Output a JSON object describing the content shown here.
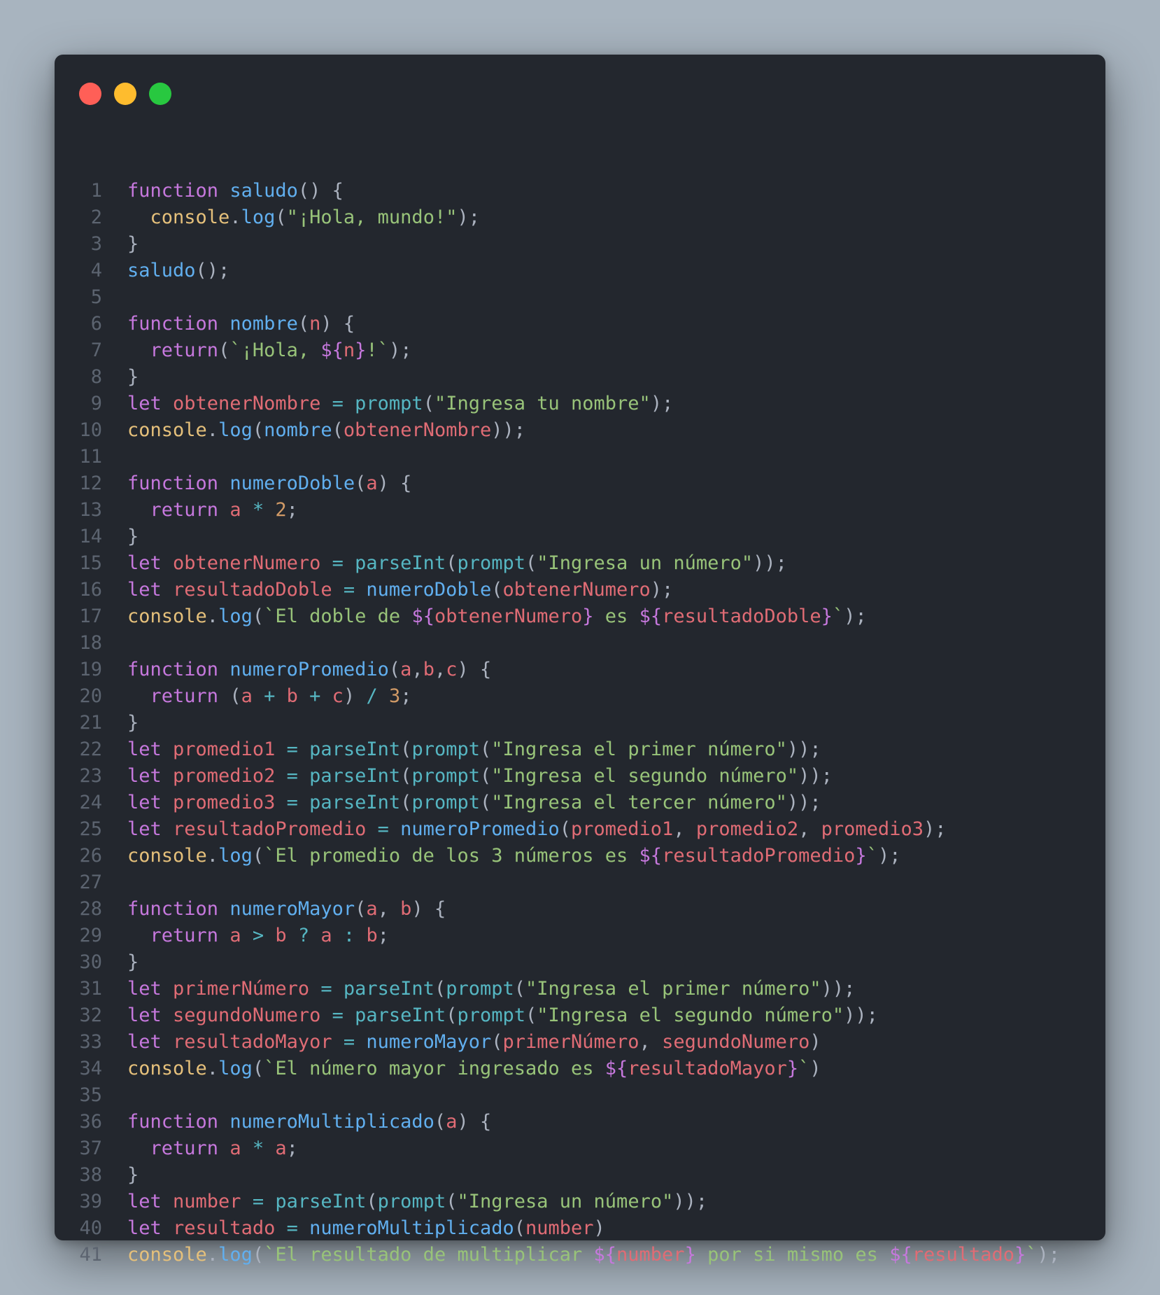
{
  "window": {
    "buttons": [
      "close",
      "minimize",
      "maximize"
    ],
    "colors": {
      "close": "#ff5f57",
      "minimize": "#febc2e",
      "maximize": "#28c840",
      "background": "#23272e",
      "keyword": "#c678dd",
      "function": "#61afef",
      "variable": "#e06c75",
      "string": "#98c379",
      "builtin": "#e5c07b",
      "number": "#d19a66",
      "operator": "#56b6c2",
      "punctuation": "#abb2bf",
      "line_number": "#5c6470"
    }
  },
  "code": {
    "language": "JavaScript",
    "lines": [
      [
        [
          "k",
          "function "
        ],
        [
          "f",
          "saludo"
        ],
        [
          "p",
          "() {"
        ]
      ],
      [
        [
          "p",
          "  "
        ],
        [
          "c",
          "console"
        ],
        [
          "p",
          "."
        ],
        [
          "f",
          "log"
        ],
        [
          "p",
          "("
        ],
        [
          "s",
          "\"¡Hola, mundo!\""
        ],
        [
          "p",
          ");"
        ]
      ],
      [
        [
          "p",
          "}"
        ]
      ],
      [
        [
          "f",
          "saludo"
        ],
        [
          "p",
          "();"
        ]
      ],
      [],
      [
        [
          "k",
          "function "
        ],
        [
          "f",
          "nombre"
        ],
        [
          "p",
          "("
        ],
        [
          "v",
          "n"
        ],
        [
          "p",
          ") {"
        ]
      ],
      [
        [
          "p",
          "  "
        ],
        [
          "k",
          "return"
        ],
        [
          "p",
          "("
        ],
        [
          "s",
          "`¡Hola, "
        ],
        [
          "k",
          "${"
        ],
        [
          "v",
          "n"
        ],
        [
          "k",
          "}"
        ],
        [
          "s",
          "!`"
        ],
        [
          "p",
          ");"
        ]
      ],
      [
        [
          "p",
          "}"
        ]
      ],
      [
        [
          "k",
          "let "
        ],
        [
          "v",
          "obtenerNombre"
        ],
        [
          "o",
          " = "
        ],
        [
          "b",
          "prompt"
        ],
        [
          "p",
          "("
        ],
        [
          "s",
          "\"Ingresa tu nombre\""
        ],
        [
          "p",
          ");"
        ]
      ],
      [
        [
          "c",
          "console"
        ],
        [
          "p",
          "."
        ],
        [
          "f",
          "log"
        ],
        [
          "p",
          "("
        ],
        [
          "f",
          "nombre"
        ],
        [
          "p",
          "("
        ],
        [
          "v",
          "obtenerNombre"
        ],
        [
          "p",
          "));"
        ]
      ],
      [],
      [
        [
          "k",
          "function "
        ],
        [
          "f",
          "numeroDoble"
        ],
        [
          "p",
          "("
        ],
        [
          "v",
          "a"
        ],
        [
          "p",
          ") {"
        ]
      ],
      [
        [
          "p",
          "  "
        ],
        [
          "k",
          "return "
        ],
        [
          "v",
          "a"
        ],
        [
          "o",
          " * "
        ],
        [
          "n",
          "2"
        ],
        [
          "p",
          ";"
        ]
      ],
      [
        [
          "p",
          "}"
        ]
      ],
      [
        [
          "k",
          "let "
        ],
        [
          "v",
          "obtenerNumero"
        ],
        [
          "o",
          " = "
        ],
        [
          "b",
          "parseInt"
        ],
        [
          "p",
          "("
        ],
        [
          "b",
          "prompt"
        ],
        [
          "p",
          "("
        ],
        [
          "s",
          "\"Ingresa un número\""
        ],
        [
          "p",
          "));"
        ]
      ],
      [
        [
          "k",
          "let "
        ],
        [
          "v",
          "resultadoDoble"
        ],
        [
          "o",
          " = "
        ],
        [
          "f",
          "numeroDoble"
        ],
        [
          "p",
          "("
        ],
        [
          "v",
          "obtenerNumero"
        ],
        [
          "p",
          ");"
        ]
      ],
      [
        [
          "c",
          "console"
        ],
        [
          "p",
          "."
        ],
        [
          "f",
          "log"
        ],
        [
          "p",
          "("
        ],
        [
          "s",
          "`El doble de "
        ],
        [
          "k",
          "${"
        ],
        [
          "v",
          "obtenerNumero"
        ],
        [
          "k",
          "}"
        ],
        [
          "s",
          " es "
        ],
        [
          "k",
          "${"
        ],
        [
          "v",
          "resultadoDoble"
        ],
        [
          "k",
          "}"
        ],
        [
          "s",
          "`"
        ],
        [
          "p",
          ");"
        ]
      ],
      [],
      [
        [
          "k",
          "function "
        ],
        [
          "f",
          "numeroPromedio"
        ],
        [
          "p",
          "("
        ],
        [
          "v",
          "a"
        ],
        [
          "p",
          ","
        ],
        [
          "v",
          "b"
        ],
        [
          "p",
          ","
        ],
        [
          "v",
          "c"
        ],
        [
          "p",
          ") {"
        ]
      ],
      [
        [
          "p",
          "  "
        ],
        [
          "k",
          "return "
        ],
        [
          "p",
          "("
        ],
        [
          "v",
          "a"
        ],
        [
          "o",
          " + "
        ],
        [
          "v",
          "b"
        ],
        [
          "o",
          " + "
        ],
        [
          "v",
          "c"
        ],
        [
          "p",
          ")"
        ],
        [
          "o",
          " / "
        ],
        [
          "n",
          "3"
        ],
        [
          "p",
          ";"
        ]
      ],
      [
        [
          "p",
          "}"
        ]
      ],
      [
        [
          "k",
          "let "
        ],
        [
          "v",
          "promedio1"
        ],
        [
          "o",
          " = "
        ],
        [
          "b",
          "parseInt"
        ],
        [
          "p",
          "("
        ],
        [
          "b",
          "prompt"
        ],
        [
          "p",
          "("
        ],
        [
          "s",
          "\"Ingresa el primer número\""
        ],
        [
          "p",
          "));"
        ]
      ],
      [
        [
          "k",
          "let "
        ],
        [
          "v",
          "promedio2"
        ],
        [
          "o",
          " = "
        ],
        [
          "b",
          "parseInt"
        ],
        [
          "p",
          "("
        ],
        [
          "b",
          "prompt"
        ],
        [
          "p",
          "("
        ],
        [
          "s",
          "\"Ingresa el segundo número\""
        ],
        [
          "p",
          "));"
        ]
      ],
      [
        [
          "k",
          "let "
        ],
        [
          "v",
          "promedio3"
        ],
        [
          "o",
          " = "
        ],
        [
          "b",
          "parseInt"
        ],
        [
          "p",
          "("
        ],
        [
          "b",
          "prompt"
        ],
        [
          "p",
          "("
        ],
        [
          "s",
          "\"Ingresa el tercer número\""
        ],
        [
          "p",
          "));"
        ]
      ],
      [
        [
          "k",
          "let "
        ],
        [
          "v",
          "resultadoPromedio"
        ],
        [
          "o",
          " = "
        ],
        [
          "f",
          "numeroPromedio"
        ],
        [
          "p",
          "("
        ],
        [
          "v",
          "promedio1"
        ],
        [
          "p",
          ", "
        ],
        [
          "v",
          "promedio2"
        ],
        [
          "p",
          ", "
        ],
        [
          "v",
          "promedio3"
        ],
        [
          "p",
          ");"
        ]
      ],
      [
        [
          "c",
          "console"
        ],
        [
          "p",
          "."
        ],
        [
          "f",
          "log"
        ],
        [
          "p",
          "("
        ],
        [
          "s",
          "`El promedio de los 3 números es "
        ],
        [
          "k",
          "${"
        ],
        [
          "v",
          "resultadoPromedio"
        ],
        [
          "k",
          "}"
        ],
        [
          "s",
          "`"
        ],
        [
          "p",
          ");"
        ]
      ],
      [],
      [
        [
          "k",
          "function "
        ],
        [
          "f",
          "numeroMayor"
        ],
        [
          "p",
          "("
        ],
        [
          "v",
          "a"
        ],
        [
          "p",
          ", "
        ],
        [
          "v",
          "b"
        ],
        [
          "p",
          ") {"
        ]
      ],
      [
        [
          "p",
          "  "
        ],
        [
          "k",
          "return "
        ],
        [
          "v",
          "a"
        ],
        [
          "o",
          " > "
        ],
        [
          "v",
          "b"
        ],
        [
          "o",
          " ? "
        ],
        [
          "v",
          "a"
        ],
        [
          "o",
          " : "
        ],
        [
          "v",
          "b"
        ],
        [
          "p",
          ";"
        ]
      ],
      [
        [
          "p",
          "}"
        ]
      ],
      [
        [
          "k",
          "let "
        ],
        [
          "v",
          "primerNúmero"
        ],
        [
          "o",
          " = "
        ],
        [
          "b",
          "parseInt"
        ],
        [
          "p",
          "("
        ],
        [
          "b",
          "prompt"
        ],
        [
          "p",
          "("
        ],
        [
          "s",
          "\"Ingresa el primer número\""
        ],
        [
          "p",
          "));"
        ]
      ],
      [
        [
          "k",
          "let "
        ],
        [
          "v",
          "segundoNumero"
        ],
        [
          "o",
          " = "
        ],
        [
          "b",
          "parseInt"
        ],
        [
          "p",
          "("
        ],
        [
          "b",
          "prompt"
        ],
        [
          "p",
          "("
        ],
        [
          "s",
          "\"Ingresa el segundo número\""
        ],
        [
          "p",
          "));"
        ]
      ],
      [
        [
          "k",
          "let "
        ],
        [
          "v",
          "resultadoMayor"
        ],
        [
          "o",
          " = "
        ],
        [
          "f",
          "numeroMayor"
        ],
        [
          "p",
          "("
        ],
        [
          "v",
          "primerNúmero"
        ],
        [
          "p",
          ", "
        ],
        [
          "v",
          "segundoNumero"
        ],
        [
          "p",
          ")"
        ]
      ],
      [
        [
          "c",
          "console"
        ],
        [
          "p",
          "."
        ],
        [
          "f",
          "log"
        ],
        [
          "p",
          "("
        ],
        [
          "s",
          "`El número mayor ingresado es "
        ],
        [
          "k",
          "${"
        ],
        [
          "v",
          "resultadoMayor"
        ],
        [
          "k",
          "}"
        ],
        [
          "s",
          "`"
        ],
        [
          "p",
          ")"
        ]
      ],
      [],
      [
        [
          "k",
          "function "
        ],
        [
          "f",
          "numeroMultiplicado"
        ],
        [
          "p",
          "("
        ],
        [
          "v",
          "a"
        ],
        [
          "p",
          ") {"
        ]
      ],
      [
        [
          "p",
          "  "
        ],
        [
          "k",
          "return "
        ],
        [
          "v",
          "a"
        ],
        [
          "o",
          " * "
        ],
        [
          "v",
          "a"
        ],
        [
          "p",
          ";"
        ]
      ],
      [
        [
          "p",
          "}"
        ]
      ],
      [
        [
          "k",
          "let "
        ],
        [
          "v",
          "number"
        ],
        [
          "o",
          " = "
        ],
        [
          "b",
          "parseInt"
        ],
        [
          "p",
          "("
        ],
        [
          "b",
          "prompt"
        ],
        [
          "p",
          "("
        ],
        [
          "s",
          "\"Ingresa un número\""
        ],
        [
          "p",
          "));"
        ]
      ],
      [
        [
          "k",
          "let "
        ],
        [
          "v",
          "resultado"
        ],
        [
          "o",
          " = "
        ],
        [
          "f",
          "numeroMultiplicado"
        ],
        [
          "p",
          "("
        ],
        [
          "v",
          "number"
        ],
        [
          "p",
          ")"
        ]
      ],
      [
        [
          "c",
          "console"
        ],
        [
          "p",
          "."
        ],
        [
          "f",
          "log"
        ],
        [
          "p",
          "("
        ],
        [
          "s",
          "`El resultado de multiplicar "
        ],
        [
          "k",
          "${"
        ],
        [
          "v",
          "number"
        ],
        [
          "k",
          "}"
        ],
        [
          "s",
          " por si mismo es "
        ],
        [
          "k",
          "${"
        ],
        [
          "v",
          "resultado"
        ],
        [
          "k",
          "}"
        ],
        [
          "s",
          "`"
        ],
        [
          "p",
          ");"
        ]
      ]
    ]
  }
}
